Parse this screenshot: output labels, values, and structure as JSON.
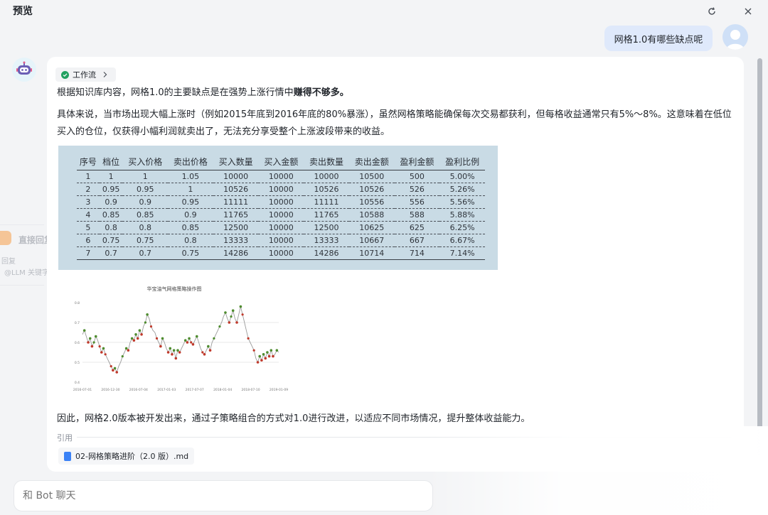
{
  "header": {
    "title": "预览"
  },
  "sidebar_fragment": {
    "title": "直接回复",
    "line1": "回复",
    "line2": "@LLM 关键字"
  },
  "user_message": "网格1.0有哪些缺点呢",
  "workflow_tag": {
    "label": "工作流"
  },
  "answer": {
    "intro_before": "根据知识库内容，网格1.0的主要缺点是在强势上涨行情中",
    "intro_bold": "赚得不够多。",
    "detail": "具体来说，当市场出现大幅上涨时（例如2015年底到2016年底的80%暴涨），虽然网格策略能确保每次交易都获利，但每格收益通常只有5%～8%。这意味着在低位买入的仓位，仅获得小幅利润就卖出了，无法充分享受整个上涨波段带来的收益。",
    "conclusion": "因此，网格2.0版本被开发出来，通过子策略组合的方式对1.0进行改进，以适应不同市场情况，提升整体收益能力。"
  },
  "grid_table": {
    "headers": [
      "序号",
      "档位",
      "买入价格",
      "卖出价格",
      "买入数量",
      "买入金额",
      "卖出数量",
      "卖出金额",
      "盈利金额",
      "盈利比例"
    ],
    "rows": [
      [
        "1",
        "1",
        "1",
        "1.05",
        "10000",
        "10000",
        "10000",
        "10500",
        "500",
        "5.00%"
      ],
      [
        "2",
        "0.95",
        "0.95",
        "1",
        "10526",
        "10000",
        "10526",
        "10526",
        "526",
        "5.26%"
      ],
      [
        "3",
        "0.9",
        "0.9",
        "0.95",
        "11111",
        "10000",
        "11111",
        "10556",
        "556",
        "5.56%"
      ],
      [
        "4",
        "0.85",
        "0.85",
        "0.9",
        "11765",
        "10000",
        "11765",
        "10588",
        "588",
        "5.88%"
      ],
      [
        "5",
        "0.8",
        "0.8",
        "0.85",
        "12500",
        "10000",
        "12500",
        "10625",
        "625",
        "6.25%"
      ],
      [
        "6",
        "0.75",
        "0.75",
        "0.8",
        "13333",
        "10000",
        "13333",
        "10667",
        "667",
        "6.67%"
      ],
      [
        "7",
        "0.7",
        "0.7",
        "0.75",
        "14286",
        "10000",
        "14286",
        "10714",
        "714",
        "7.14%"
      ]
    ]
  },
  "chart_data": {
    "type": "line",
    "title": "华宝油气网格策略操作图",
    "xlabel": "",
    "ylabel": "",
    "x_ticks": [
      "2016-07-01",
      "2016-12-30",
      "2016-07-04",
      "2017-01-03",
      "2017-07-07",
      "2018-01-04",
      "2018-07-10",
      "2019-01-09"
    ],
    "y_ticks": [
      0.4,
      0.5,
      0.6,
      0.7,
      0.8
    ],
    "ylim": [
      0.4,
      0.8
    ],
    "grid": true,
    "series": [
      {
        "values": [
          0.64,
          0.66,
          0.63,
          0.6,
          0.62,
          0.58,
          0.6,
          0.63,
          0.61,
          0.58,
          0.55,
          0.57,
          0.54,
          0.52,
          0.5,
          0.48,
          0.46,
          0.47,
          0.45,
          0.48,
          0.5,
          0.53,
          0.55,
          0.57,
          0.56,
          0.6,
          0.62,
          0.61,
          0.64,
          0.62,
          0.66,
          0.64,
          0.68,
          0.7,
          0.74,
          0.72,
          0.68,
          0.66,
          0.65,
          0.62,
          0.6,
          0.58,
          0.62,
          0.6,
          0.57,
          0.55,
          0.57,
          0.54,
          0.56,
          0.52,
          0.56,
          0.55,
          0.57,
          0.59,
          0.61,
          0.6,
          0.62,
          0.6,
          0.59,
          0.61,
          0.63,
          0.6,
          0.57,
          0.55,
          0.54,
          0.56,
          0.58,
          0.56,
          0.6,
          0.62,
          0.64,
          0.66,
          0.68,
          0.7,
          0.73,
          0.75,
          0.72,
          0.7,
          0.73,
          0.76,
          0.72,
          0.7,
          0.74,
          0.78,
          0.74,
          0.7,
          0.66,
          0.62,
          0.6,
          0.58,
          0.56,
          0.52,
          0.5,
          0.53,
          0.51,
          0.54,
          0.52,
          0.55,
          0.53,
          0.56,
          0.53,
          0.54,
          0.56,
          0.55
        ]
      }
    ],
    "markers": {
      "buy_color": "#4e8c2e",
      "sell_color": "#c0392b"
    }
  },
  "citation": {
    "label": "引用",
    "file": "02-网格策略进阶（2.0 版）.md"
  },
  "input": {
    "placeholder": "和 Bot 聊天"
  },
  "colors": {
    "accent": "#2f6fe4",
    "user_bubble": "#dfe9fb",
    "table_bg": "#c9dbe5",
    "check": "#22a060"
  }
}
